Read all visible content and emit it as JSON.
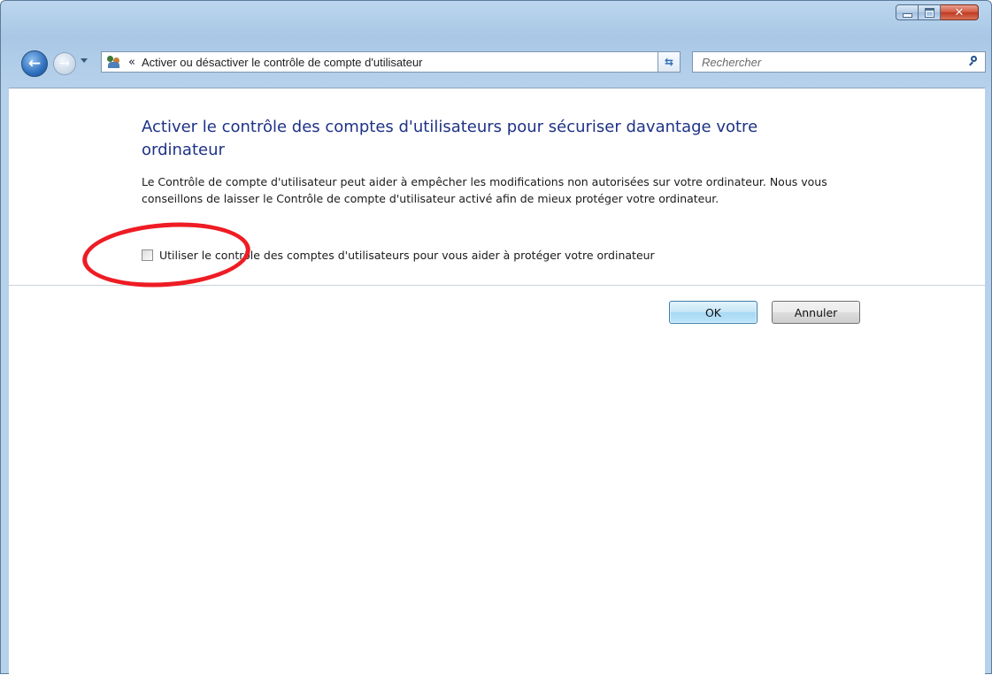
{
  "window": {
    "address_path": "Activer ou désactiver le contrôle de compte d'utilisateur",
    "chevron": "«"
  },
  "search": {
    "placeholder": "Rechercher"
  },
  "main": {
    "heading": "Activer le contrôle des comptes d'utilisateurs pour sécuriser davantage votre ordinateur",
    "description": "Le Contrôle de compte d'utilisateur peut aider à empêcher les modifications non autorisées sur votre ordinateur. Nous vous conseillons de laisser le Contrôle de compte d'utilisateur activé afin de mieux protéger votre ordinateur.",
    "checkbox_label": "Utiliser le contrôle des comptes d'utilisateurs pour vous aider à protéger votre ordinateur",
    "checkbox_checked": false
  },
  "buttons": {
    "ok": "OK",
    "cancel": "Annuler"
  },
  "icons": {
    "back": "back-arrow-icon",
    "forward": "forward-arrow-icon",
    "recent": "chevron-down-icon",
    "location": "user-accounts-icon",
    "refresh": "refresh-icon",
    "search": "search-icon"
  },
  "colors": {
    "heading": "#1e3287",
    "annotation": "#ee1c24"
  }
}
